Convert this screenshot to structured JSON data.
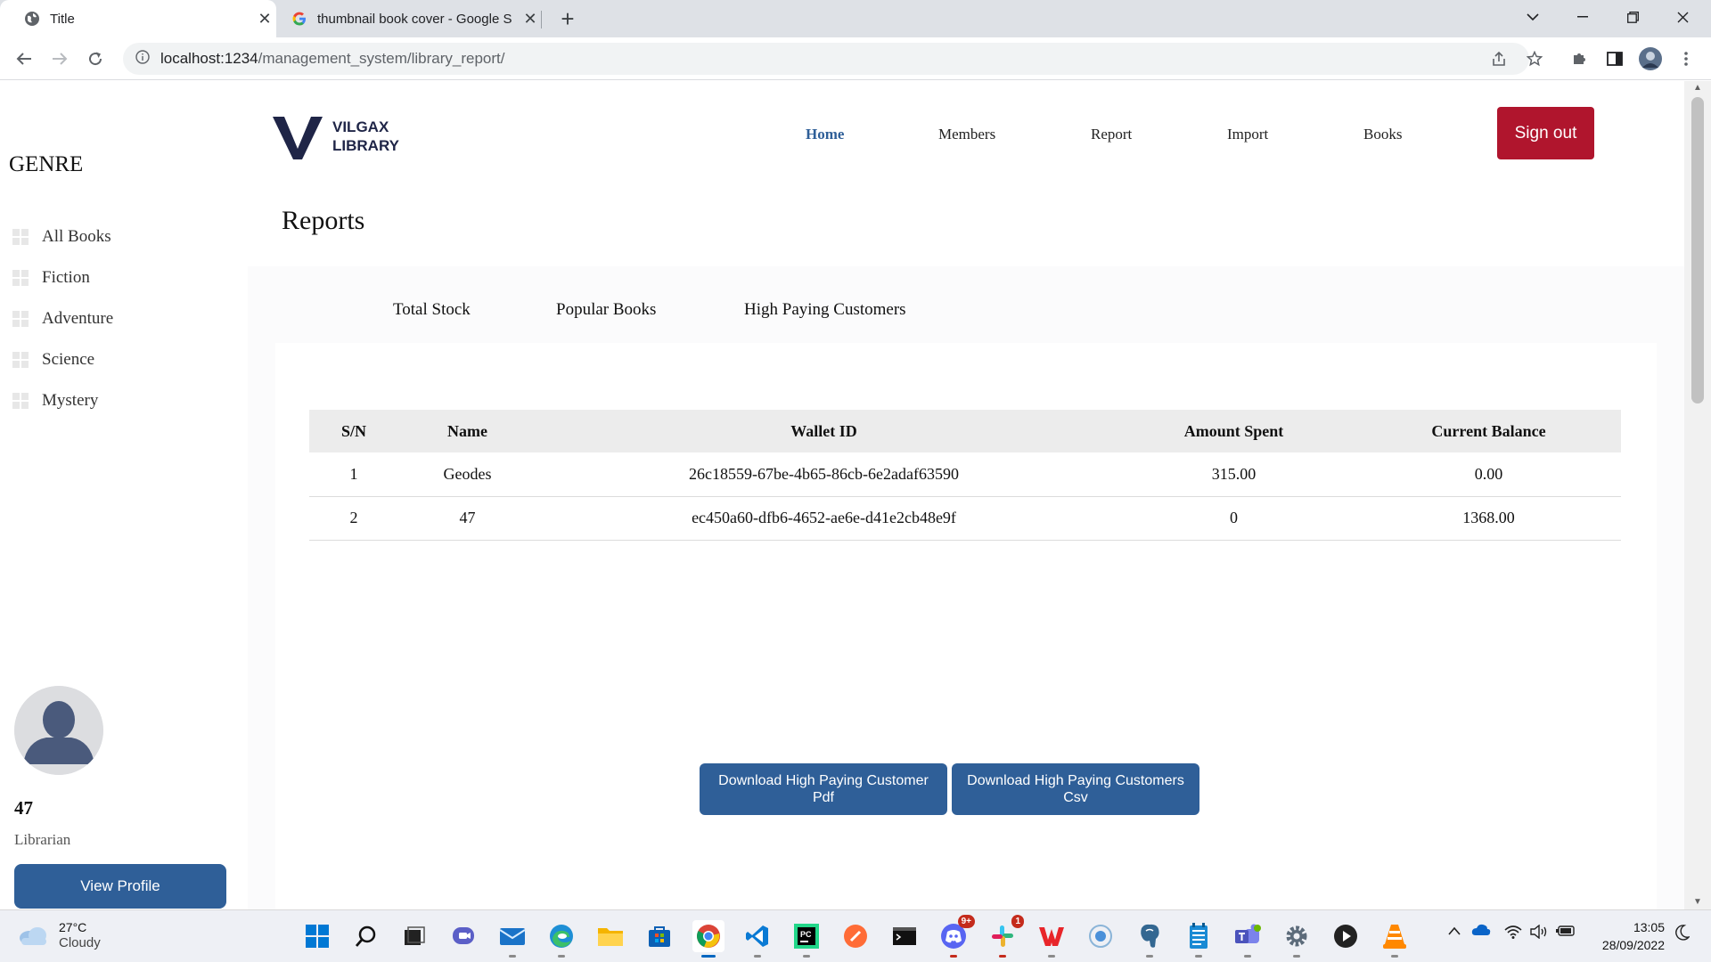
{
  "browser": {
    "tabs": [
      {
        "title": "Title",
        "active": true
      },
      {
        "title": "thumbnail book cover - Google S",
        "active": false
      }
    ],
    "url_host": "localhost:1234",
    "url_path": "/management_system/library_report/"
  },
  "logo": {
    "line1": "VILGAX",
    "line2": "LIBRARY"
  },
  "nav": {
    "home": "Home",
    "members": "Members",
    "report": "Report",
    "import": "Import",
    "books": "Books",
    "sign_out": "Sign out"
  },
  "sidebar": {
    "title": "GENRE",
    "items": [
      "All Books",
      "Fiction",
      "Adventure",
      "Science",
      "Mystery"
    ],
    "user": {
      "name": "47",
      "role": "Librarian",
      "profile_button": "View Profile"
    }
  },
  "page": {
    "heading": "Reports",
    "tabs": [
      "Total Stock",
      "Popular Books",
      "High Paying Customers"
    ],
    "table": {
      "columns": [
        "S/N",
        "Name",
        "Wallet ID",
        "Amount Spent",
        "Current Balance"
      ],
      "rows": [
        [
          "1",
          "Geodes",
          "26c18559-67be-4b65-86cb-6e2adaf63590",
          "315.00",
          "0.00"
        ],
        [
          "2",
          "47",
          "ec450a60-dfb6-4652-ae6e-d41e2cb48e9f",
          "0",
          "1368.00"
        ]
      ]
    },
    "buttons": {
      "pdf": "Download High Paying Customer Pdf",
      "csv": "Download High Paying Customers Csv"
    }
  },
  "taskbar": {
    "weather": {
      "temp": "27°C",
      "condition": "Cloudy"
    },
    "time": "13:05",
    "date": "28/09/2022",
    "discord_badge": "9+",
    "slack_badge": "1"
  },
  "colors": {
    "primary": "#2f5f98",
    "signout": "#b0152d",
    "logo": "#1f2547"
  }
}
